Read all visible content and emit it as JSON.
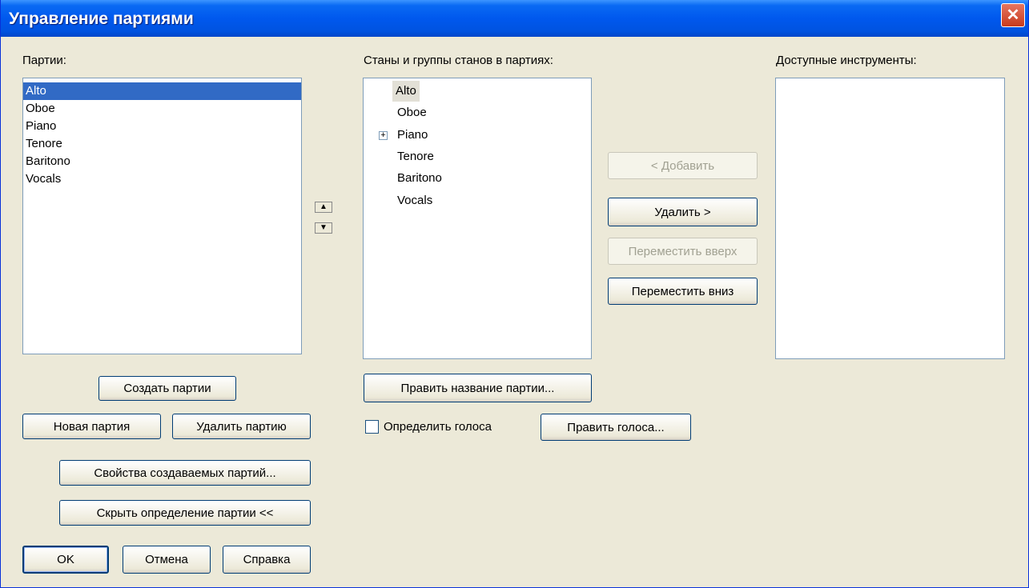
{
  "window": {
    "title": "Управление партиями",
    "close_icon": "close-icon"
  },
  "parts": {
    "label": "Партии:",
    "items": [
      "Alto",
      "Oboe",
      "Piano",
      "Tenore",
      "Baritono",
      "Vocals"
    ],
    "selected": "Alto"
  },
  "staves": {
    "label": "Станы и группы станов в партиях:",
    "items": [
      "Alto",
      "Oboe",
      "Piano",
      "Tenore",
      "Baritono",
      "Vocals"
    ],
    "selected": "Alto",
    "expandable": "Piano"
  },
  "instruments": {
    "label": "Доступные инструменты:",
    "items": []
  },
  "buttons": {
    "create_parts": "Создать партии",
    "new_part": "Новая партия",
    "delete_part": "Удалить партию",
    "properties": "Свойства создаваемых партий...",
    "hide_definition": "Скрыть определение партии <<",
    "ok": "OK",
    "cancel": "Отмена",
    "help": "Справка",
    "edit_name": "Править название партии...",
    "edit_voices": "Править голоса...",
    "add": "< Добавить",
    "remove": "Удалить >",
    "move_up": "Переместить вверх",
    "move_down": "Переместить вниз"
  },
  "define_voices": {
    "label": "Определить голоса",
    "checked": false
  },
  "icons": {
    "up": "▲",
    "down": "▼",
    "expand": "+",
    "close": "✕"
  }
}
